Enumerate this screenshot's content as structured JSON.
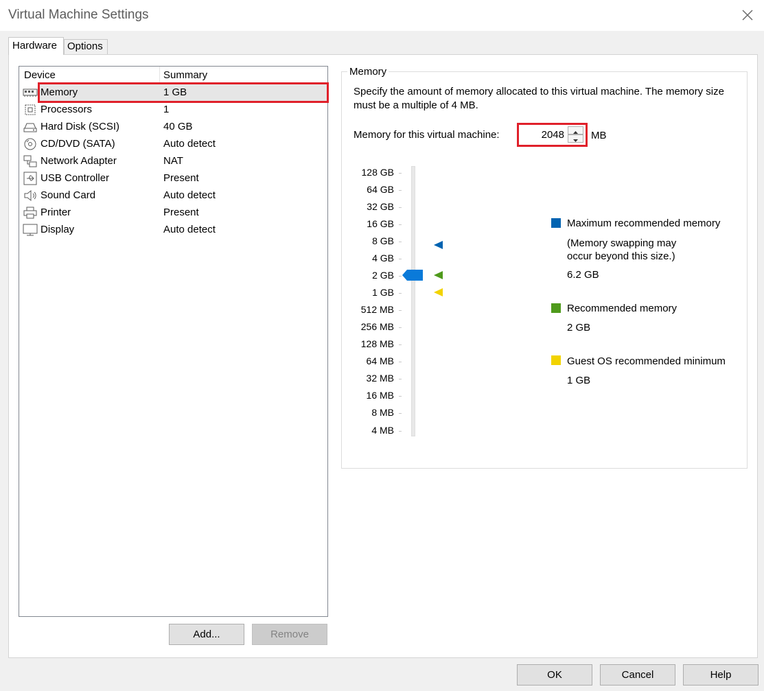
{
  "window": {
    "title": "Virtual Machine Settings"
  },
  "tabs": {
    "hardware": "Hardware",
    "options": "Options"
  },
  "device_list": {
    "headers": {
      "device": "Device",
      "summary": "Summary"
    },
    "rows": [
      {
        "name": "Memory",
        "summary": "1 GB",
        "icon": "memory-icon"
      },
      {
        "name": "Processors",
        "summary": "1",
        "icon": "processor-icon"
      },
      {
        "name": "Hard Disk (SCSI)",
        "summary": "40 GB",
        "icon": "hard-disk-icon"
      },
      {
        "name": "CD/DVD (SATA)",
        "summary": "Auto detect",
        "icon": "cd-dvd-icon"
      },
      {
        "name": "Network Adapter",
        "summary": "NAT",
        "icon": "network-adapter-icon"
      },
      {
        "name": "USB Controller",
        "summary": "Present",
        "icon": "usb-icon"
      },
      {
        "name": "Sound Card",
        "summary": "Auto detect",
        "icon": "speaker-icon"
      },
      {
        "name": "Printer",
        "summary": "Present",
        "icon": "printer-icon"
      },
      {
        "name": "Display",
        "summary": "Auto detect",
        "icon": "monitor-icon"
      }
    ]
  },
  "buttons": {
    "add": "Add...",
    "remove": "Remove",
    "ok": "OK",
    "cancel": "Cancel",
    "help": "Help"
  },
  "memory": {
    "group_title": "Memory",
    "description": "Specify the amount of memory allocated to this virtual machine. The memory size must be a multiple of 4 MB.",
    "field_label": "Memory for this virtual machine:",
    "value": "2048",
    "unit": "MB",
    "scale_labels": [
      "128 GB",
      "64 GB",
      "32 GB",
      "16 GB",
      "8 GB",
      "4 GB",
      "2 GB",
      "1 GB",
      "512 MB",
      "256 MB",
      "128 MB",
      "64 MB",
      "32 MB",
      "16 MB",
      "8 MB",
      "4 MB"
    ],
    "slider_level": "2 GB",
    "legend": {
      "max_label": "Maximum recommended memory",
      "max_note": "(Memory swapping may occur beyond this size.)",
      "max_value": "6.2 GB",
      "rec_label": "Recommended memory",
      "rec_value": "2 GB",
      "min_label": "Guest OS recommended minimum",
      "min_value": "1 GB"
    },
    "colors": {
      "max": "#0063b1",
      "recommended": "#4f9a1c",
      "minimum": "#f2d300",
      "thumb": "#0a7ad9"
    }
  }
}
